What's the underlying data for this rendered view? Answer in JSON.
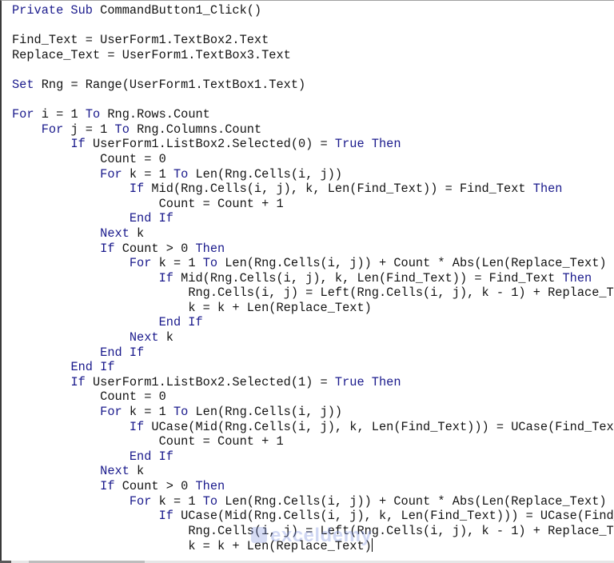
{
  "editor": {
    "language": "VBA",
    "colors": {
      "keyword": "#1a1a8c",
      "text": "#141414",
      "background": "#ffffff"
    },
    "lines": [
      {
        "indent": 0,
        "tokens": [
          [
            "kw",
            "Private Sub"
          ],
          [
            "tx",
            " CommandButton1_Click()"
          ]
        ]
      },
      {
        "indent": 0,
        "tokens": []
      },
      {
        "indent": 0,
        "tokens": [
          [
            "tx",
            "Find_Text = UserForm1.TextBox2.Text"
          ]
        ]
      },
      {
        "indent": 0,
        "tokens": [
          [
            "tx",
            "Replace_Text = UserForm1.TextBox3.Text"
          ]
        ]
      },
      {
        "indent": 0,
        "tokens": []
      },
      {
        "indent": 0,
        "tokens": [
          [
            "kw",
            "Set"
          ],
          [
            "tx",
            " Rng = Range(UserForm1.TextBox1.Text)"
          ]
        ]
      },
      {
        "indent": 0,
        "tokens": []
      },
      {
        "indent": 0,
        "tokens": [
          [
            "kw",
            "For"
          ],
          [
            "tx",
            " i = 1 "
          ],
          [
            "kw",
            "To"
          ],
          [
            "tx",
            " Rng.Rows.Count"
          ]
        ]
      },
      {
        "indent": 1,
        "tokens": [
          [
            "kw",
            "For"
          ],
          [
            "tx",
            " j = 1 "
          ],
          [
            "kw",
            "To"
          ],
          [
            "tx",
            " Rng.Columns.Count"
          ]
        ]
      },
      {
        "indent": 2,
        "tokens": [
          [
            "kw",
            "If"
          ],
          [
            "tx",
            " UserForm1.ListBox2.Selected(0) = "
          ],
          [
            "kw",
            "True Then"
          ]
        ]
      },
      {
        "indent": 3,
        "tokens": [
          [
            "tx",
            "Count = 0"
          ]
        ]
      },
      {
        "indent": 3,
        "tokens": [
          [
            "kw",
            "For"
          ],
          [
            "tx",
            " k = 1 "
          ],
          [
            "kw",
            "To"
          ],
          [
            "tx",
            " Len(Rng.Cells(i, j))"
          ]
        ]
      },
      {
        "indent": 4,
        "tokens": [
          [
            "kw",
            "If"
          ],
          [
            "tx",
            " Mid(Rng.Cells(i, j), k, Len(Find_Text)) = Find_Text "
          ],
          [
            "kw",
            "Then"
          ]
        ]
      },
      {
        "indent": 5,
        "tokens": [
          [
            "tx",
            "Count = Count + 1"
          ]
        ]
      },
      {
        "indent": 4,
        "tokens": [
          [
            "kw",
            "End If"
          ]
        ]
      },
      {
        "indent": 3,
        "tokens": [
          [
            "kw",
            "Next"
          ],
          [
            "tx",
            " k"
          ]
        ]
      },
      {
        "indent": 3,
        "tokens": [
          [
            "kw",
            "If"
          ],
          [
            "tx",
            " Count > 0 "
          ],
          [
            "kw",
            "Then"
          ]
        ]
      },
      {
        "indent": 4,
        "tokens": [
          [
            "kw",
            "For"
          ],
          [
            "tx",
            " k = 1 "
          ],
          [
            "kw",
            "To"
          ],
          [
            "tx",
            " Len(Rng.Cells(i, j)) + Count * Abs(Len(Replace_Text) - Len(Find_Text))"
          ]
        ]
      },
      {
        "indent": 5,
        "tokens": [
          [
            "kw",
            "If"
          ],
          [
            "tx",
            " Mid(Rng.Cells(i, j), k, Len(Find_Text)) = Find_Text "
          ],
          [
            "kw",
            "Then"
          ]
        ]
      },
      {
        "indent": 6,
        "tokens": [
          [
            "tx",
            "Rng.Cells(i, j) = Left(Rng.Cells(i, j), k - 1) + Replace_Text + Right(Rng.Cells(i, j), Len(Rng.Cells(i, j)) - k - Len(Find_Text) + 1)"
          ]
        ]
      },
      {
        "indent": 6,
        "tokens": [
          [
            "tx",
            "k = k + Len(Replace_Text)"
          ]
        ]
      },
      {
        "indent": 5,
        "tokens": [
          [
            "kw",
            "End If"
          ]
        ]
      },
      {
        "indent": 4,
        "tokens": [
          [
            "kw",
            "Next"
          ],
          [
            "tx",
            " k"
          ]
        ]
      },
      {
        "indent": 3,
        "tokens": [
          [
            "kw",
            "End If"
          ]
        ]
      },
      {
        "indent": 2,
        "tokens": [
          [
            "kw",
            "End If"
          ]
        ]
      },
      {
        "indent": 2,
        "tokens": [
          [
            "kw",
            "If"
          ],
          [
            "tx",
            " UserForm1.ListBox2.Selected(1) = "
          ],
          [
            "kw",
            "True Then"
          ]
        ]
      },
      {
        "indent": 3,
        "tokens": [
          [
            "tx",
            "Count = 0"
          ]
        ]
      },
      {
        "indent": 3,
        "tokens": [
          [
            "kw",
            "For"
          ],
          [
            "tx",
            " k = 1 "
          ],
          [
            "kw",
            "To"
          ],
          [
            "tx",
            " Len(Rng.Cells(i, j))"
          ]
        ]
      },
      {
        "indent": 4,
        "tokens": [
          [
            "kw",
            "If"
          ],
          [
            "tx",
            " UCase(Mid(Rng.Cells(i, j), k, Len(Find_Text))) = UCase(Find_Text) "
          ],
          [
            "kw",
            "Then"
          ]
        ]
      },
      {
        "indent": 5,
        "tokens": [
          [
            "tx",
            "Count = Count + 1"
          ]
        ]
      },
      {
        "indent": 4,
        "tokens": [
          [
            "kw",
            "End If"
          ]
        ]
      },
      {
        "indent": 3,
        "tokens": [
          [
            "kw",
            "Next"
          ],
          [
            "tx",
            " k"
          ]
        ]
      },
      {
        "indent": 3,
        "tokens": [
          [
            "kw",
            "If"
          ],
          [
            "tx",
            " Count > 0 "
          ],
          [
            "kw",
            "Then"
          ]
        ]
      },
      {
        "indent": 4,
        "tokens": [
          [
            "kw",
            "For"
          ],
          [
            "tx",
            " k = 1 "
          ],
          [
            "kw",
            "To"
          ],
          [
            "tx",
            " Len(Rng.Cells(i, j)) + Count * Abs(Len(Replace_Text) - Len(Find_Text))"
          ]
        ]
      },
      {
        "indent": 5,
        "tokens": [
          [
            "kw",
            "If"
          ],
          [
            "tx",
            " UCase(Mid(Rng.Cells(i, j), k, Len(Find_Text))) = UCase(Find_Text) "
          ],
          [
            "kw",
            "Then"
          ]
        ]
      },
      {
        "indent": 6,
        "tokens": [
          [
            "tx",
            "Rng.Cells(i, j) = Left(Rng.Cells(i, j), k - 1) + Replace_Text + Right(Rng.Cells(i, j), Len(Rng.Cells(i, j)) - k - Len(Find_Text) + 1)"
          ]
        ]
      },
      {
        "indent": 6,
        "tokens": [
          [
            "tx",
            "k = k + Len(Replace_Text)"
          ]
        ],
        "caret": true
      }
    ]
  },
  "watermark": {
    "text": "exceldemy"
  }
}
